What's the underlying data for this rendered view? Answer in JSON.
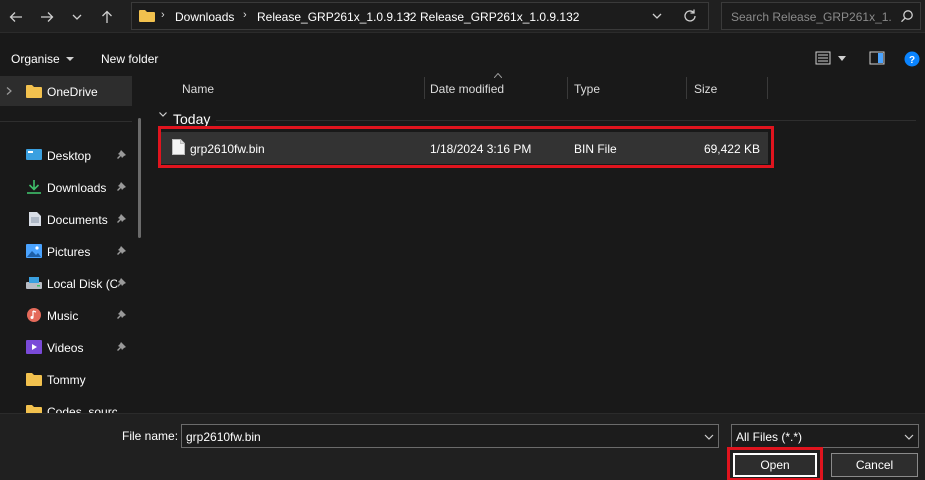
{
  "breadcrumbs": [
    "Downloads",
    "Release_GRP261x_1.0.9.132",
    "Release_GRP261x_1.0.9.132"
  ],
  "search": {
    "placeholder": "Search Release_GRP261x_1...."
  },
  "toolbar": {
    "organise_label": "Organise",
    "new_folder_label": "New folder"
  },
  "sidebar": {
    "items": [
      {
        "label": "OneDrive",
        "icon": "folder-icon",
        "pinned": false
      },
      {
        "label": "Desktop",
        "icon": "desktop-icon",
        "pinned": true
      },
      {
        "label": "Downloads",
        "icon": "download-icon",
        "pinned": true
      },
      {
        "label": "Documents",
        "icon": "documents-icon",
        "pinned": true
      },
      {
        "label": "Pictures",
        "icon": "pictures-icon",
        "pinned": true
      },
      {
        "label": "Local Disk (C",
        "icon": "disk-icon",
        "pinned": true
      },
      {
        "label": "Music",
        "icon": "music-icon",
        "pinned": true
      },
      {
        "label": "Videos",
        "icon": "videos-icon",
        "pinned": true
      },
      {
        "label": "Tommy",
        "icon": "folder-icon",
        "pinned": false
      },
      {
        "label": "Codes_source",
        "icon": "folder-icon",
        "pinned": false
      }
    ]
  },
  "columns": {
    "name": "Name",
    "date": "Date modified",
    "type": "Type",
    "size": "Size"
  },
  "group": {
    "label": "Today"
  },
  "files": [
    {
      "name": "grp2610fw.bin",
      "date": "1/18/2024 3:16 PM",
      "type": "BIN File",
      "size": "69,422 KB"
    }
  ],
  "bottom": {
    "filename_label": "File name:",
    "filename_value": "grp2610fw.bin",
    "filetype_value": "All Files (*.*)",
    "open_label": "Open",
    "cancel_label": "Cancel"
  },
  "colors": {
    "highlight": "#e0141e",
    "folder": "#f2c14e",
    "accent": "#0a84ff"
  }
}
